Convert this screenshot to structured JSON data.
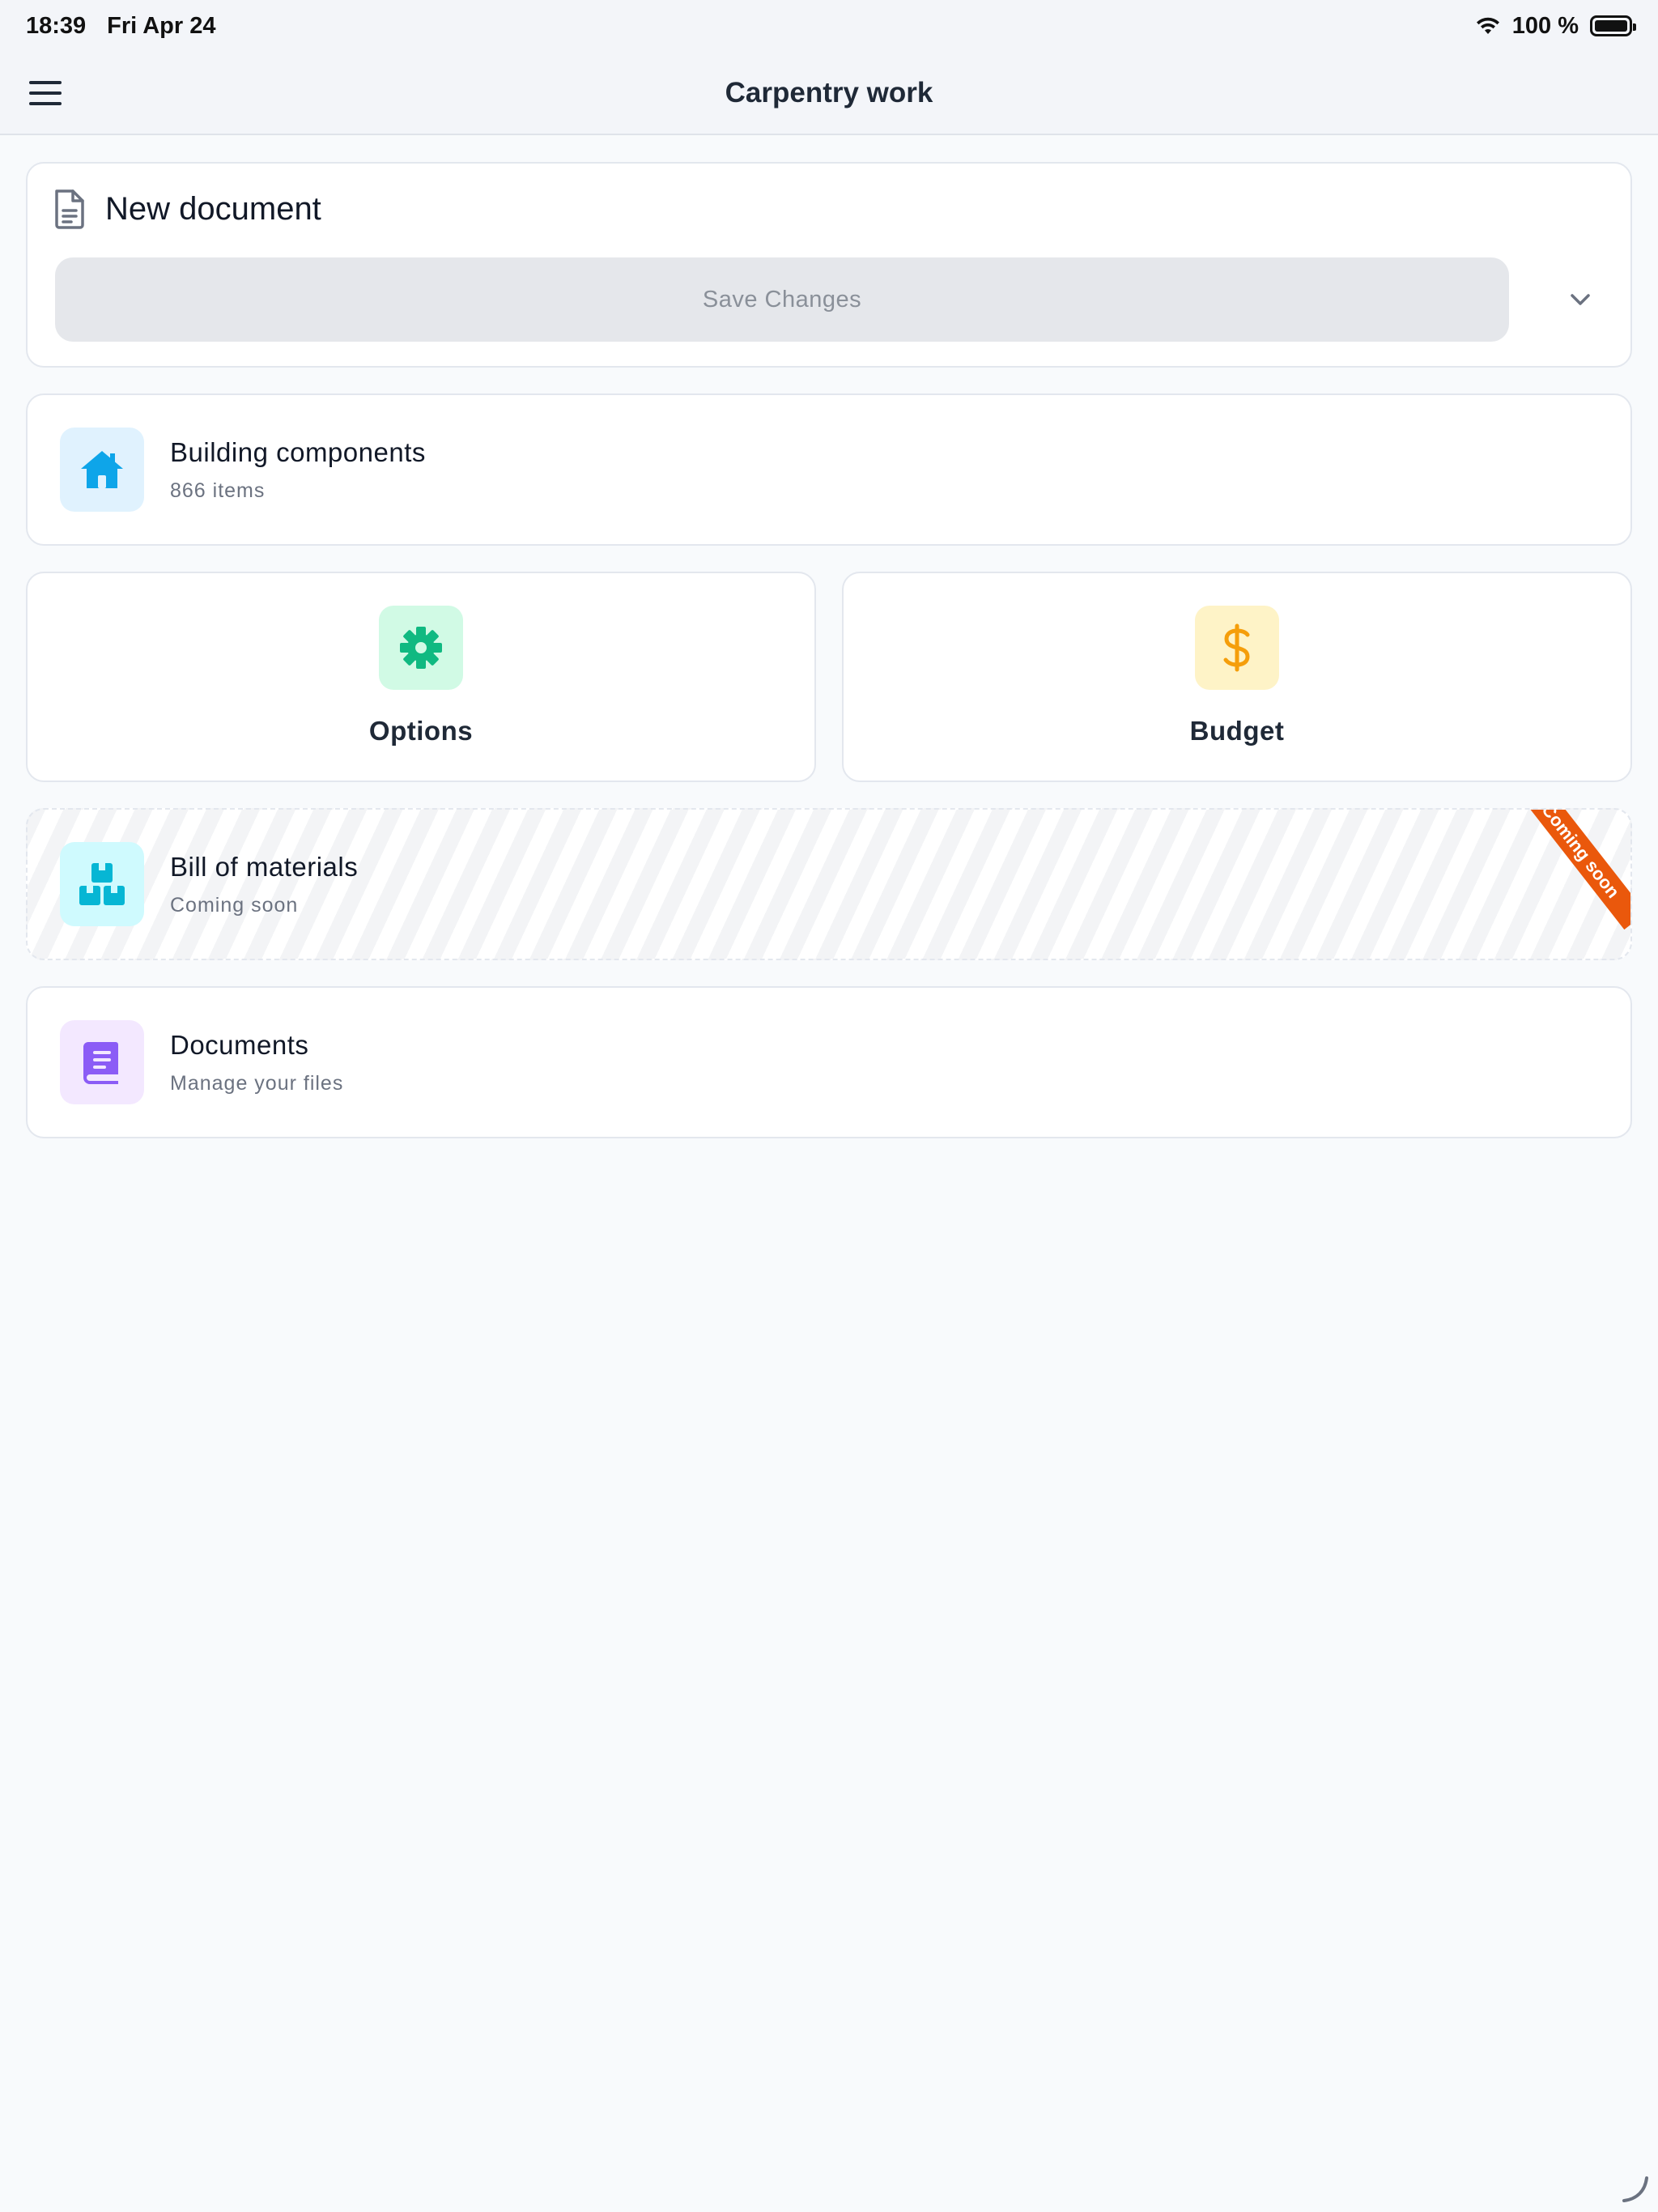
{
  "status_bar": {
    "time": "18:39",
    "date": "Fri Apr 24",
    "battery": "100 %",
    "wifi_icon": "wifi-icon",
    "battery_icon": "battery-icon"
  },
  "nav": {
    "title": "Carpentry work",
    "menu_icon": "hamburger-menu-icon"
  },
  "document": {
    "icon": "document-icon",
    "title": "New document",
    "save_label": "Save Changes",
    "expand_icon": "chevron-down-icon"
  },
  "building_components": {
    "icon": "home-icon",
    "title": "Building components",
    "subtitle": "866 items",
    "icon_bg": "#e0f2fe",
    "icon_color": "#0ea5e9"
  },
  "options": {
    "icon": "gear-icon",
    "label": "Options",
    "icon_bg": "#d1fae5",
    "icon_color": "#10b981"
  },
  "budget": {
    "icon": "dollar-icon",
    "label": "Budget",
    "icon_bg": "#fef3c7",
    "icon_color": "#f59e0b"
  },
  "bill_of_materials": {
    "icon": "boxes-icon",
    "title": "Bill of materials",
    "subtitle": "Coming soon",
    "ribbon": "Coming soon",
    "icon_bg": "#cffafe",
    "icon_color": "#06b6d4",
    "ribbon_color": "#ea580c"
  },
  "documents": {
    "icon": "book-icon",
    "title": "Documents",
    "subtitle": "Manage your files",
    "icon_bg": "#f3e8ff",
    "icon_color": "#8b5cf6"
  }
}
